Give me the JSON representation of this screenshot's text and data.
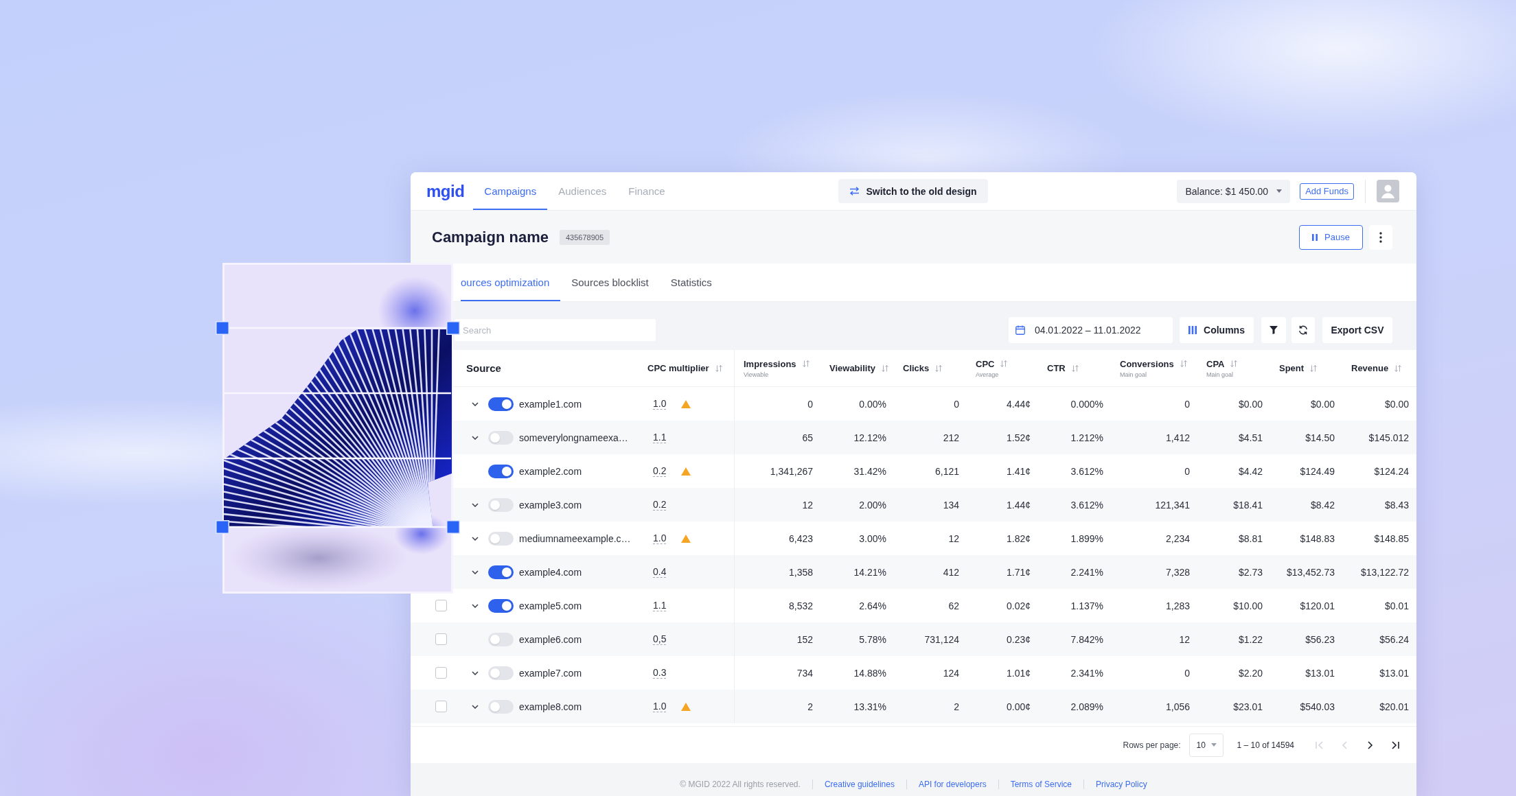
{
  "nav": {
    "logo": "mgid",
    "tabs": [
      {
        "label": "Campaigns",
        "selected": true
      },
      {
        "label": "Audiences",
        "selected": false
      },
      {
        "label": "Finance",
        "selected": false
      }
    ],
    "switch_button": "Switch to the old design",
    "balance": "Balance: $1 450.00",
    "add_funds_button": "Add Funds"
  },
  "campaign": {
    "title": "Campaign name",
    "id": "435678905",
    "pause_button": "Pause"
  },
  "tabs": [
    {
      "label": "ources optimization",
      "selected": true
    },
    {
      "label": "Sources blocklist",
      "selected": false
    },
    {
      "label": "Statistics",
      "selected": false
    }
  ],
  "toolbar": {
    "search": {
      "placeholder": "Search"
    },
    "date_range": "04.01.2022 – 11.01.2022",
    "columns_button": "Columns",
    "export_button": "Export CSV"
  },
  "table": {
    "columns": [
      {
        "label": "Source",
        "sortable": false
      },
      {
        "label": "CPC multiplier",
        "sortable": true
      },
      {
        "label": "Impressions",
        "sublabel": "Viewable",
        "sortable": true
      },
      {
        "label": "Viewability",
        "sortable": true
      },
      {
        "label": "Clicks",
        "sortable": true
      },
      {
        "label": "CPC",
        "sublabel": "Average",
        "sortable": true
      },
      {
        "label": "CTR",
        "sortable": true
      },
      {
        "label": "Conversions",
        "sublabel": "Main goal",
        "sortable": true
      },
      {
        "label": "CPA",
        "sublabel": "Main goal",
        "sortable": true
      },
      {
        "label": "Spent",
        "sortable": true
      },
      {
        "label": "Revenue",
        "sortable": true
      }
    ],
    "rows": [
      {
        "expandable": true,
        "on": true,
        "source": "example1.com",
        "cpc_multiplier": "1.0",
        "warning": true,
        "cells": [
          "0",
          "0.00%",
          "0",
          "4.44¢",
          "0.000%",
          "0",
          "$0.00",
          "$0.00",
          "$0.00"
        ]
      },
      {
        "expandable": true,
        "on": false,
        "source": "someverylongnameexa…",
        "cpc_multiplier": "1.1",
        "warning": false,
        "cells": [
          "65",
          "12.12%",
          "212",
          "1.52¢",
          "1.212%",
          "1,412",
          "$4.51",
          "$14.50",
          "$145.012"
        ]
      },
      {
        "expandable": false,
        "on": true,
        "source": "example2.com",
        "cpc_multiplier": "0.2",
        "warning": true,
        "cells": [
          "1,341,267",
          "31.42%",
          "6,121",
          "1.41¢",
          "3.612%",
          "0",
          "$4.42",
          "$124.49",
          "$124.24"
        ]
      },
      {
        "expandable": true,
        "on": false,
        "source": "example3.com",
        "cpc_multiplier": "0.2",
        "warning": false,
        "cells": [
          "12",
          "2.00%",
          "134",
          "1.44¢",
          "3.612%",
          "121,341",
          "$18.41",
          "$8.42",
          "$8.43"
        ]
      },
      {
        "expandable": true,
        "on": false,
        "source": "mediumnameexample.c…",
        "cpc_multiplier": "1.0",
        "warning": true,
        "cells": [
          "6,423",
          "3.00%",
          "12",
          "1.82¢",
          "1.899%",
          "2,234",
          "$8.81",
          "$148.83",
          "$148.85"
        ]
      },
      {
        "expandable": true,
        "on": true,
        "source": "example4.com",
        "cpc_multiplier": "0.4",
        "warning": false,
        "cells": [
          "1,358",
          "14.21%",
          "412",
          "1.71¢",
          "2.241%",
          "7,328",
          "$2.73",
          "$13,452.73",
          "$13,122.72"
        ]
      },
      {
        "checked": false,
        "expandable": true,
        "on": true,
        "source": "example5.com",
        "cpc_multiplier": "1.1",
        "warning": false,
        "cells": [
          "8,532",
          "2.64%",
          "62",
          "0.02¢",
          "1.137%",
          "1,283",
          "$10.00",
          "$120.01",
          "$0.01"
        ]
      },
      {
        "checked": false,
        "expandable": false,
        "on": false,
        "source": "example6.com",
        "cpc_multiplier": "0,5",
        "warning": false,
        "cells": [
          "152",
          "5.78%",
          "731,124",
          "0.23¢",
          "7.842%",
          "12",
          "$1.22",
          "$56.23",
          "$56.24"
        ]
      },
      {
        "checked": false,
        "expandable": true,
        "on": false,
        "source": "example7.com",
        "cpc_multiplier": "0.3",
        "warning": false,
        "cells": [
          "734",
          "14.88%",
          "124",
          "1.01¢",
          "2.341%",
          "0",
          "$2.20",
          "$13.01",
          "$13.01"
        ]
      },
      {
        "checked": false,
        "expandable": true,
        "on": false,
        "source": "example8.com",
        "cpc_multiplier": "1.0",
        "warning": true,
        "cells": [
          "2",
          "13.31%",
          "2",
          "0.00¢",
          "2.089%",
          "1,056",
          "$23.01",
          "$540.03",
          "$20.01"
        ]
      }
    ]
  },
  "pagination": {
    "rows_per_page_label": "Rows per page:",
    "rows_per_page": "10",
    "range": "1 – 10 of 14594",
    "nav_buttons": [
      {
        "kind": "first",
        "disabled": true
      },
      {
        "kind": "prev",
        "disabled": true
      },
      {
        "kind": "next",
        "disabled": false
      },
      {
        "kind": "last",
        "disabled": false
      }
    ]
  },
  "footer": {
    "copyright": "© MGID 2022 All rights reserved.",
    "links": [
      "Creative guidelines",
      "API for developers",
      "Terms of Service",
      "Privacy Policy"
    ]
  }
}
